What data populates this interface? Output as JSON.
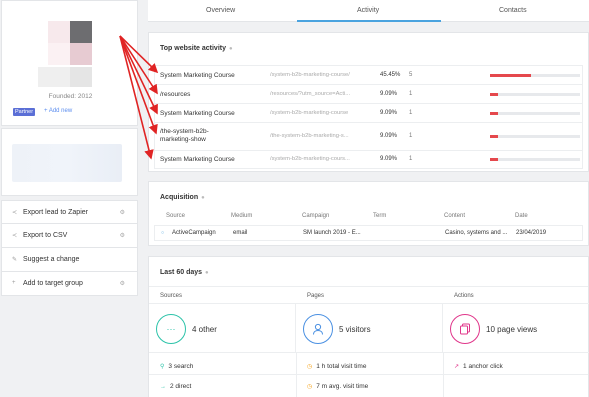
{
  "sidebar": {
    "founded": "Founded: 2012",
    "partner_badge": "Partner",
    "add_new": "+ Add new",
    "menu": [
      {
        "label": "Export lead to Zapier",
        "icon": "share-icon"
      },
      {
        "label": "Export to CSV",
        "icon": "share-icon"
      },
      {
        "label": "Suggest a change",
        "icon": "pencil-icon"
      },
      {
        "label": "Add to target group",
        "icon": "plus-icon"
      }
    ]
  },
  "tabs": [
    "Overview",
    "Activity",
    "Contacts"
  ],
  "top_activity": {
    "title": "Top website activity",
    "rows": [
      {
        "page": "System Marketing Course",
        "url": "/system-b2b-marketing-course/",
        "pct": "45.45%",
        "count": "5",
        "share": 0.4545
      },
      {
        "page": "/resources",
        "url": "/resources/?utm_source=Acti...",
        "pct": "9.09%",
        "count": "1",
        "share": 0.0909
      },
      {
        "page": "System Marketing Course",
        "url": "/system-b2b-marketing-course",
        "pct": "9.09%",
        "count": "1",
        "share": 0.0909
      },
      {
        "page": "/the-system-b2b-marketing-show",
        "url": "/the-system-b2b-marketing-s...",
        "pct": "9.09%",
        "count": "1",
        "share": 0.0909
      },
      {
        "page": "System Marketing Course",
        "url": "/system-b2b-marketing-cours...",
        "pct": "9.09%",
        "count": "1",
        "share": 0.0909
      }
    ]
  },
  "acquisition": {
    "title": "Acquisition",
    "headers": [
      "Source",
      "Medium",
      "Campaign",
      "Term",
      "Content",
      "Date"
    ],
    "row": [
      "ActiveCampaign",
      "email",
      "SM launch 2019 - E...",
      "",
      "Casino, systems and ...",
      "23/04/2019"
    ]
  },
  "last60": {
    "title": "Last 60 days",
    "columns": [
      "Sources",
      "Pages",
      "Actions"
    ],
    "stats": [
      "4 other",
      "5 visitors",
      "10 page views"
    ],
    "sources": [
      "3 search",
      "2 direct"
    ],
    "pages": [
      "1 h total visit time",
      "7 m avg. visit time"
    ],
    "actions": [
      "1 anchor click"
    ]
  },
  "colors": {
    "accent": "#4aa3df",
    "bar": "#e5484d",
    "arrow": "#e02424",
    "teal": "#2cc3a9",
    "blue": "#4a90e2",
    "pink": "#e0358a",
    "orange": "#f5a623"
  }
}
